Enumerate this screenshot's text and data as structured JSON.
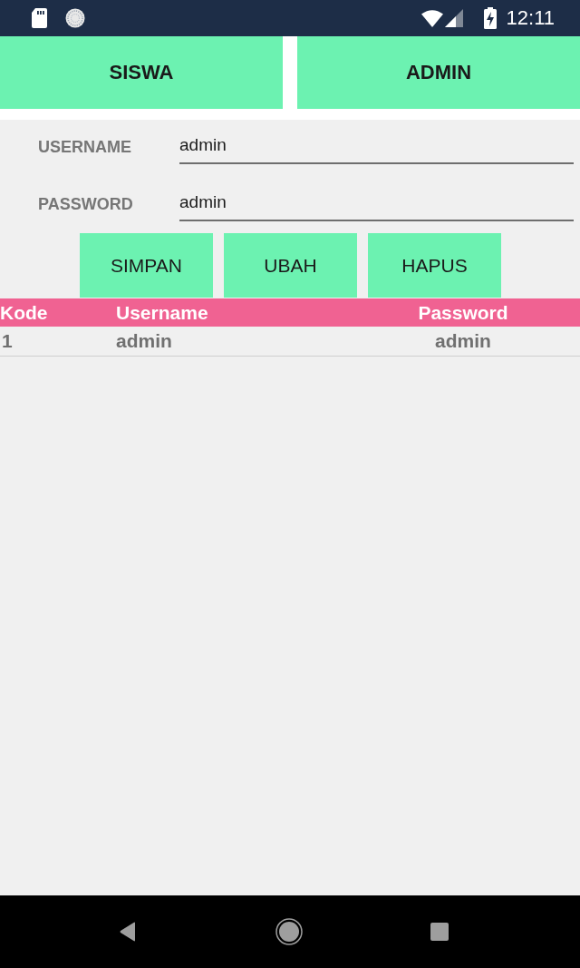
{
  "status_bar": {
    "time": "12:11"
  },
  "top_buttons": [
    {
      "label": "SISWA"
    },
    {
      "label": "ADMIN"
    }
  ],
  "form": {
    "fields": [
      {
        "label": "USERNAME",
        "value": "admin"
      },
      {
        "label": "PASSWORD",
        "value": "admin"
      }
    ]
  },
  "actions": [
    {
      "label": "SIMPAN"
    },
    {
      "label": "UBAH"
    },
    {
      "label": "HAPUS"
    }
  ],
  "table": {
    "columns": [
      "Kode",
      "Username",
      "Password"
    ],
    "rows": [
      [
        "1",
        "admin",
        "admin"
      ]
    ]
  }
}
